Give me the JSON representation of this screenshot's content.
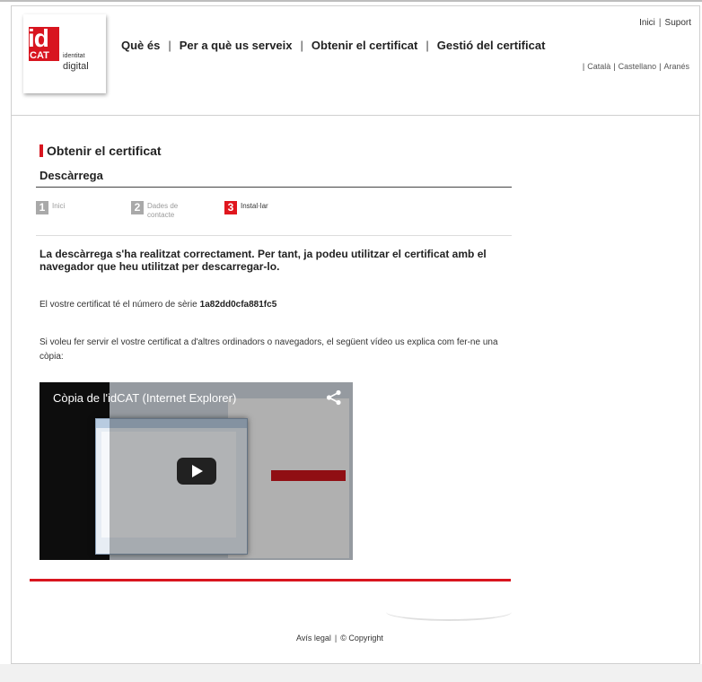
{
  "header": {
    "logo": {
      "big": "id",
      "small": "CAT",
      "tagline_top": "identitat",
      "tagline_bottom": "digital"
    },
    "toplinks": [
      "Inici",
      "Suport"
    ],
    "nav": [
      "Què és",
      "Per a què us serveix",
      "Obtenir el certificat",
      "Gestió del certificat"
    ],
    "languages": [
      "Català",
      "Castellano",
      "Aranés"
    ]
  },
  "content": {
    "title": "Obtenir el certificat",
    "subtitle": "Descàrrega",
    "steps": [
      {
        "num": "1",
        "label_line1": "Inici",
        "label_line2": "",
        "state": "inactive"
      },
      {
        "num": "2",
        "label_line1": "Dades de",
        "label_line2": "contacte",
        "state": "inactive"
      },
      {
        "num": "3",
        "label_line1": "Instal·lar",
        "label_line2": "",
        "state": "active"
      }
    ],
    "success_message": "La descàrrega s'ha realitzat correctament. Per tant, ja podeu utilitzar el certificat amb el navegador que heu utilitzat per descarregar-lo.",
    "serial_prefix": "El vostre certificat té el número de sèrie",
    "serial_number": "1a82dd0cfa881fc5",
    "info_text": "Si voleu fer servir el vostre certificat a d'altres ordinadors o navegadors, el següent vídeo us explica com fer-ne una còpia:",
    "video": {
      "title": "Còpia de l'idCAT (Internet Explorer)"
    }
  },
  "footer": {
    "legal": "Avís legal",
    "copyright": "© Copyright"
  },
  "colors": {
    "accent": "#d8151f"
  }
}
